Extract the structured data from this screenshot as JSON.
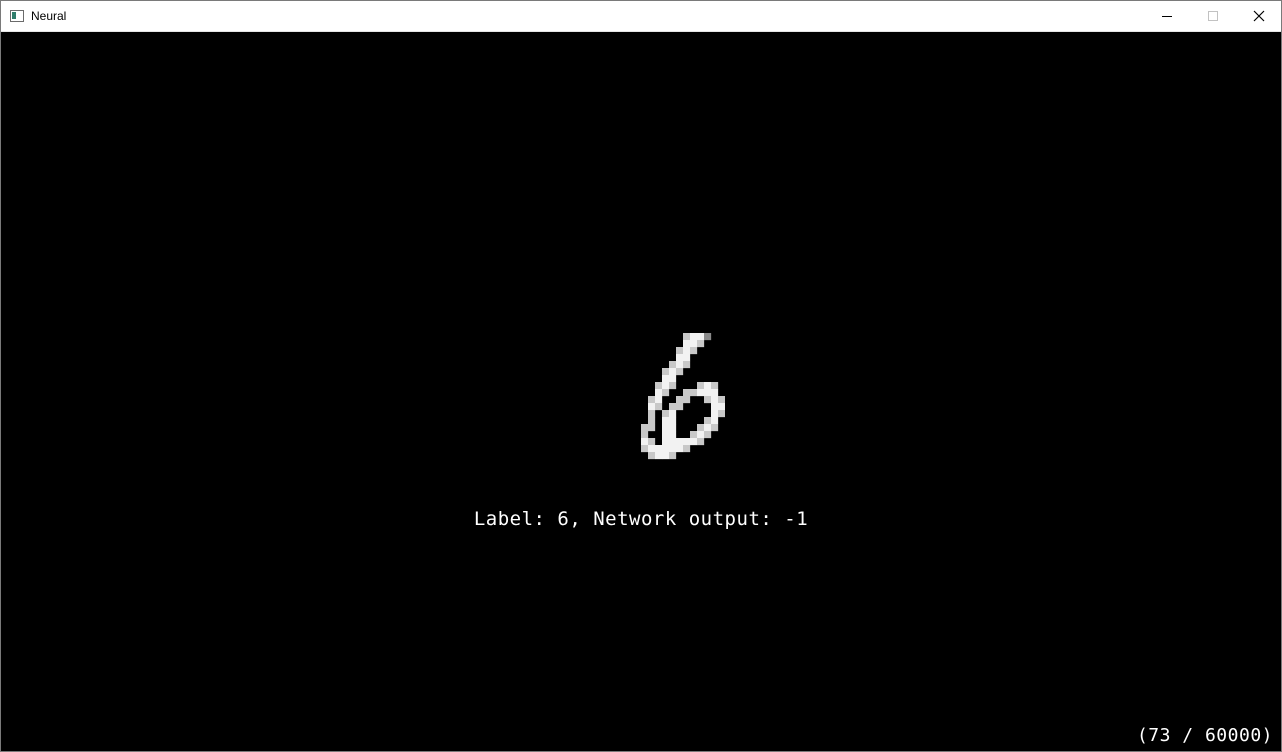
{
  "window": {
    "title": "Neural",
    "controls": [
      "minimize",
      "maximize",
      "close"
    ]
  },
  "display": {
    "label_text": "Label: 6, Network output: -1",
    "label": 6,
    "network_output": -1,
    "sample_counter": "(73 / 60000)",
    "sample_index": 73,
    "sample_total": 60000,
    "digit_image": {
      "description_name": "mnist-digit",
      "pixels": [
        "....................",
        "..............####..",
        "..............###...",
        ".............###....",
        ".............##.....",
        "............###.....",
        "...........###......",
        "...........##.......",
        "..........###...###.",
        "..........##..#####.",
        ".........##..##..###",
        ".........##.##....##",
        ".........#.##.....##",
        ".........#.##....##.",
        "........##.##...###.",
        "........#..##..###..",
        "........##.######...",
        "........#######.....",
        ".........####......."
      ]
    }
  }
}
